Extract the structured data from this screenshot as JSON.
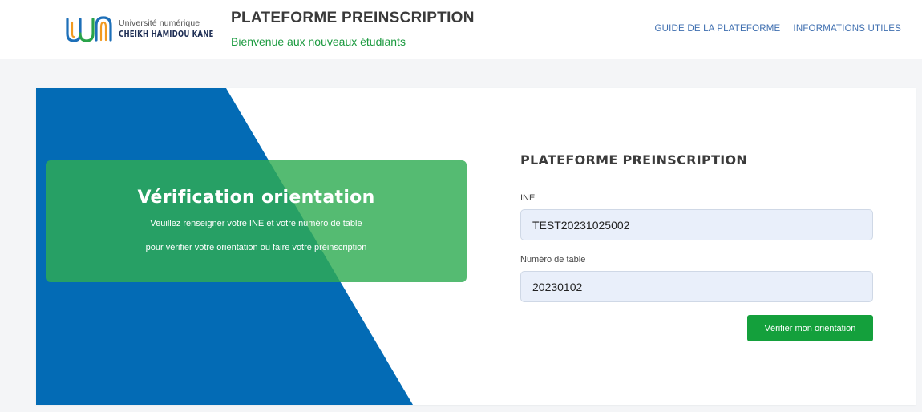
{
  "header": {
    "logo": {
      "line1": "Université numérique",
      "line2": "CHEIKH HAMIDOU KANE"
    },
    "title": "PLATEFORME PREINSCRIPTION",
    "subtitle": "Bienvenue aux nouveaux étudiants",
    "nav": [
      {
        "label": "GUIDE DE LA PLATEFORME"
      },
      {
        "label": "INFORMATIONS UTILES"
      }
    ]
  },
  "banner": {
    "title": "Vérification orientation",
    "line1": "Veuillez renseigner votre INE et votre numéro de table",
    "line2": "pour vérifier votre orientation ou faire votre préinscription"
  },
  "form": {
    "title": "PLATEFORME PREINSCRIPTION",
    "ine_label": "INE",
    "ine_value": "TEST20231025002",
    "table_label": "Numéro de table",
    "table_value": "20230102",
    "submit_label": "Vérifier mon orientation"
  },
  "colors": {
    "blue": "#036bb5",
    "green": "#2fac53",
    "button_green": "#14a03c",
    "nav_link": "#3f6fb0"
  }
}
